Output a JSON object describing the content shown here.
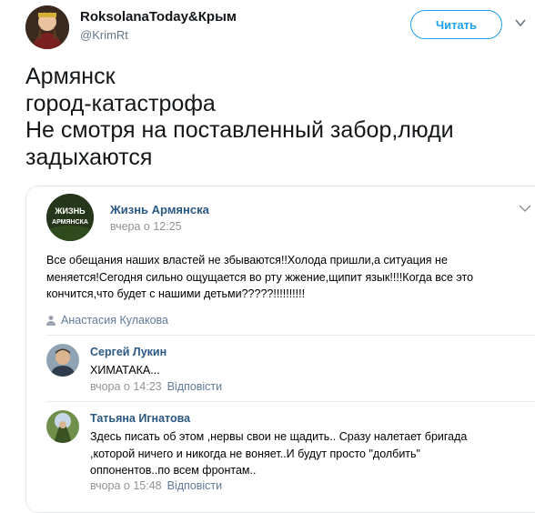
{
  "tweet": {
    "display_name": "RoksolanaToday&Крым",
    "handle": "@KrimRt",
    "follow_label": "Читать",
    "text_lines": [
      "Армянск",
      "город-катастрофа",
      "Не смотря на поставленный забор,люди",
      "задыхаются"
    ]
  },
  "vk_post": {
    "group_name": "Жизнь Армянска",
    "group_logo_text": [
      "ЖИЗНЬ",
      "АРМЯНСКА"
    ],
    "time": "вчера о 12:25",
    "body_lines": [
      "Все обещания наших властей не збываются!!Холода пришли,а ситуация не",
      "меняется!Сегодня сильно ощущается во рту жжение,щипит язык!!!!Когда все это",
      "кончится,что будет с нашими детьми?????!!!!!!!!!!"
    ],
    "author": "Анастасия Кулакова",
    "comments": [
      {
        "name": "Сергей Лукин",
        "text_lines": [
          "ХИМАТАКА..."
        ],
        "time": "вчора о 14:23",
        "reply": "Відповісти"
      },
      {
        "name": "Татьяна Игнатова",
        "text_lines": [
          "Здесь писать об этом ,нервы свои не щадить.. Сразу налетает бригада",
          ",которой ничего и никогда не воняет..И будут просто \"долбить\"",
          "оппонентов..по всем фронтам.."
        ],
        "time": "вчора о 15:48",
        "reply": "Відповісти"
      }
    ]
  },
  "colors": {
    "twitter_blue": "#1da1f2",
    "vk_link": "#2a5885",
    "meta_gray": "#939393"
  }
}
